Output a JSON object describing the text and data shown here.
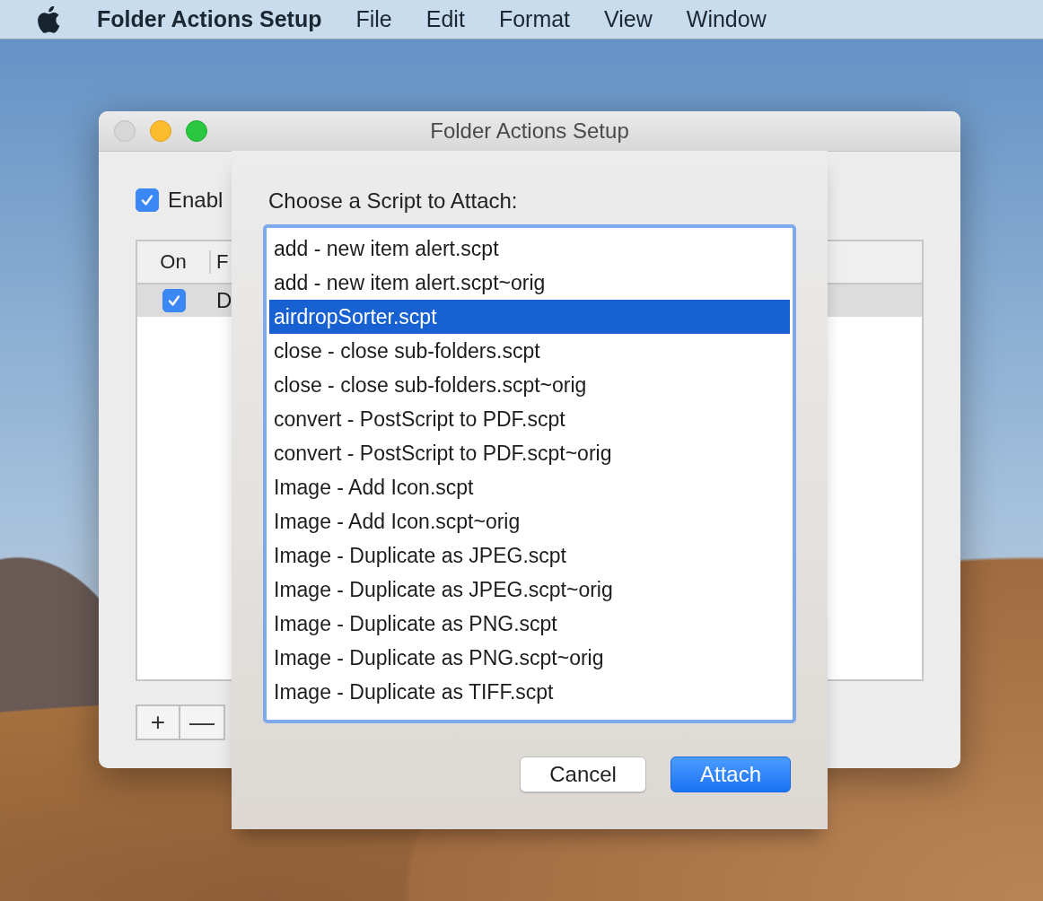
{
  "menu_bar": {
    "app_name": "Folder Actions Setup",
    "items": [
      "File",
      "Edit",
      "Format",
      "View",
      "Window"
    ]
  },
  "window": {
    "title": "Folder Actions Setup",
    "enable_checkbox": {
      "label": "Enabl",
      "checked": true
    },
    "table": {
      "columns": [
        "On",
        "F"
      ],
      "rows": [
        {
          "on": true,
          "column_2": "D",
          "selected": true
        }
      ]
    },
    "buttons": [
      "+",
      "—"
    ]
  },
  "sheet": {
    "prompt": "Choose a Script to Attach:",
    "scripts": [
      {
        "name": "add - new item alert.scpt",
        "selected": false
      },
      {
        "name": "add - new item alert.scpt~orig",
        "selected": false
      },
      {
        "name": "airdropSorter.scpt",
        "selected": true
      },
      {
        "name": "close - close sub-folders.scpt",
        "selected": false
      },
      {
        "name": "close - close sub-folders.scpt~orig",
        "selected": false
      },
      {
        "name": "convert - PostScript to PDF.scpt",
        "selected": false
      },
      {
        "name": "convert - PostScript to PDF.scpt~orig",
        "selected": false
      },
      {
        "name": "Image - Add Icon.scpt",
        "selected": false
      },
      {
        "name": "Image - Add Icon.scpt~orig",
        "selected": false
      },
      {
        "name": "Image - Duplicate as JPEG.scpt",
        "selected": false
      },
      {
        "name": "Image - Duplicate as JPEG.scpt~orig",
        "selected": false
      },
      {
        "name": "Image - Duplicate as PNG.scpt",
        "selected": false
      },
      {
        "name": "Image - Duplicate as PNG.scpt~orig",
        "selected": false
      },
      {
        "name": "Image - Duplicate as TIFF.scpt",
        "selected": false
      }
    ],
    "buttons": [
      {
        "label": "Cancel",
        "kind": "secondary"
      },
      {
        "label": "Attach",
        "kind": "default"
      }
    ]
  }
}
